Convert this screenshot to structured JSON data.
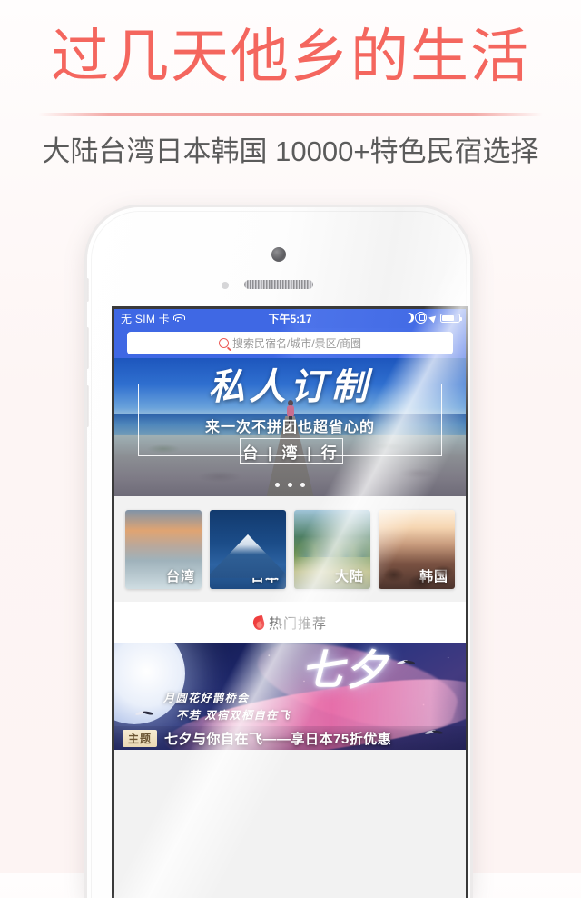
{
  "promo": {
    "title": "过几天他乡的生活",
    "subtitle": "大陆台湾日本韩国 10000+特色民宿选择",
    "title_color": "#f4665e",
    "subtitle_color": "#5b5b5b"
  },
  "phone": {
    "status_bar": {
      "carrier": "无 SIM 卡",
      "wifi_icon": "wifi-icon",
      "time": "下午5:17",
      "dnd_icon": "moon-icon",
      "rotation_lock_icon": "rotation-lock-icon",
      "location_icon": "location-arrow-icon",
      "battery_icon": "battery-icon",
      "background_color": "#3f68e4"
    },
    "search": {
      "icon": "search-icon",
      "placeholder": "搜索民宿名/城市/景区/商圈"
    },
    "banner": {
      "title": "私人订制",
      "subtitle": "来一次不拼团也超省心的",
      "destination": "台 | 湾 | 行",
      "dots": 3,
      "active_dot": 1
    },
    "tiles": [
      {
        "label": "台湾",
        "name": "tile-taiwan"
      },
      {
        "label": "日本",
        "name": "tile-japan"
      },
      {
        "label": "大陆",
        "name": "tile-mainland"
      },
      {
        "label": "韩国",
        "name": "tile-korea"
      }
    ],
    "hot_section": {
      "icon": "flame-icon",
      "title": "热门推荐",
      "icon_color": "#ef3e3e"
    },
    "promo_card": {
      "headline": "七夕",
      "poem_line1": "月圆花好鹊桥会",
      "poem_line2": "不若 双宿双栖自在飞",
      "badge": "主题",
      "caption": "七夕与你自在飞——享日本75折优惠"
    }
  }
}
